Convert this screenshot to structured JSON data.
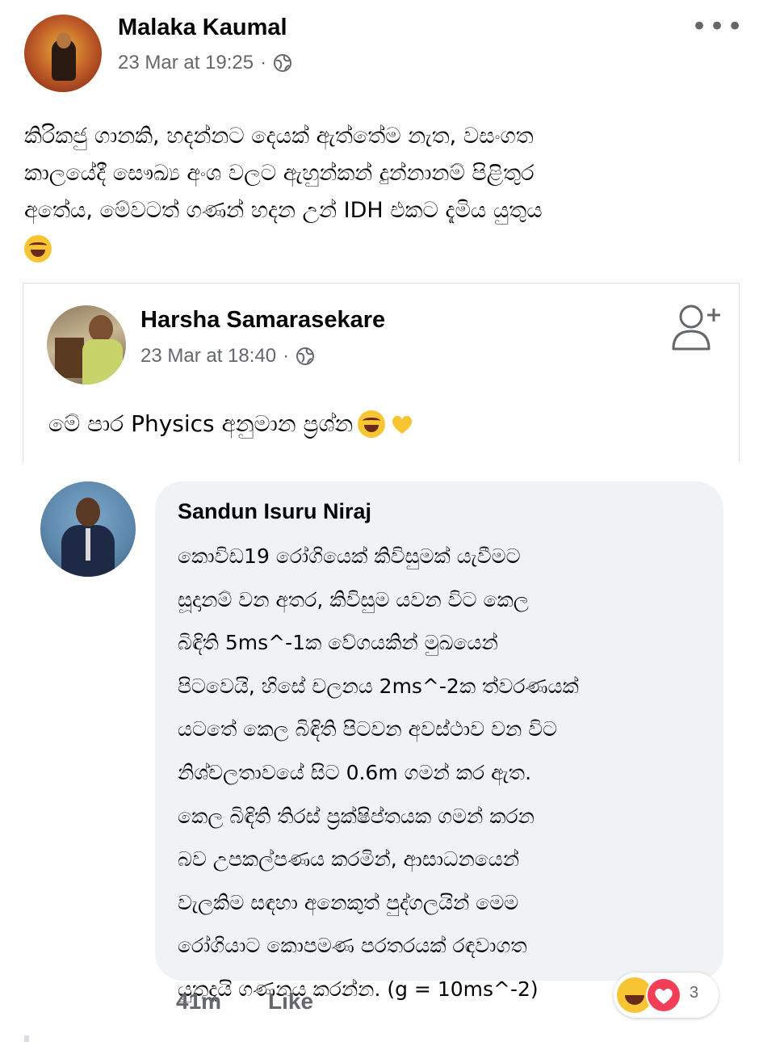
{
  "post": {
    "author": "Malaka Kaumal",
    "timestamp": "23 Mar at 19:25",
    "separator": "·",
    "privacy_icon": "globe-icon",
    "more_icon": "more-dots-icon",
    "more_label": "•••",
    "text_lines": [
      "කිරිකජු ගානකි, හදන්නට දෙයක් ඇත්තේම නැත, වසංගත",
      "කාලයේදී සෞඛ්‍ය අංශ වලට ඇහුන්කන් දුන්නානම් පිළිතුර",
      "අතේය, මේවටත් ගණන් හදන උන් IDH එකට දැමිය යුතුය"
    ],
    "emoji": "laughing-tears-emoji"
  },
  "shared": {
    "author": "Harsha Samarasekare",
    "timestamp": "23 Mar at 18:40",
    "separator": "·",
    "privacy_icon": "globe-icon",
    "add_friend_icon": "add-friend-icon",
    "text": "මේ පාර Physics අනුමාන ප්‍රශ්න",
    "emojis": [
      "laughing-tears-emoji",
      "yellow-heart-emoji"
    ]
  },
  "comment": {
    "author": "Sandun Isuru Niraj",
    "lines": [
      "කොවිඩ19 රෝගියෙක් කිවිසුමක් යැවීමට",
      "සූදානම් වන අතර, කිවිසුම යවන විට කෙල",
      "බිඳිති 5ms^-1ක වේගයකින් මුඛයෙන්",
      "පිටවෙයි, හිසේ චලනය 2ms^-2ක ත්වරණයක්",
      "යටතේ කෙල බිඳිති පිටවන අවස්ථාව වන විට",
      "නිශ්චලතාවයේ සිට 0.6m ගමන් කර ඇත.",
      "කෙල බිඳිති තිරස් ප්‍රක්ෂිප්තයක ගමන් කරන",
      "බව උපකල්පණය කරමින්, ආසාධනයෙන්",
      "වැලකිම සඳහා අනෙකුත් පුද්ගලයින් මෙම",
      "රෝගියාට කොපමණ පරතරයක් රඳවාගත",
      "යුතුදැයි ගණනය කරන්න. (g = 10ms^-2)"
    ],
    "time": "41m",
    "like_label": "Like",
    "reaction_count": "3",
    "reaction_icons": [
      "haha-reaction-icon",
      "love-reaction-icon"
    ]
  },
  "colors": {
    "text_primary": "#050505",
    "text_secondary": "#65676b",
    "bubble_bg": "#f0f2f5",
    "border": "#dadde1",
    "love": "#f33e58",
    "haha": "#f7c534"
  }
}
